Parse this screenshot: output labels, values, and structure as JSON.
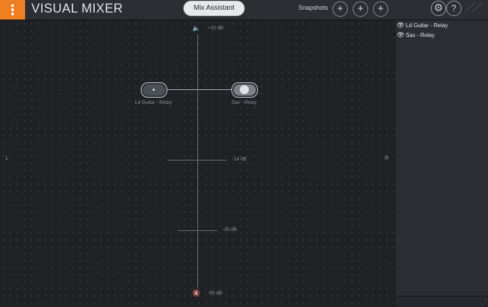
{
  "app": {
    "title": "VISUAL MIXER"
  },
  "toolbar": {
    "mix_assistant_label": "Mix Assistant",
    "snapshots_label": "Snapshots",
    "snapshot_add_glyph": "+",
    "settings_icon": "gear-icon",
    "help_glyph": "?",
    "accent_color": "#f07f22"
  },
  "stage": {
    "db_labels": {
      "top": "+10 dB",
      "mid": "-14 dB",
      "low": "-35 dB",
      "bottom": "-60 dB"
    },
    "left_label": "L",
    "right_label": "R",
    "tracks": [
      {
        "label": "Ld Guitar - Relay",
        "selected": false
      },
      {
        "label": "Sax - Relay",
        "selected": true
      }
    ]
  },
  "track_list": [
    {
      "name": "Ld Guitar - Relay",
      "visibility_icon": "eye-icon"
    },
    {
      "name": "Sax - Relay",
      "visibility_icon": "eye-icon"
    }
  ]
}
